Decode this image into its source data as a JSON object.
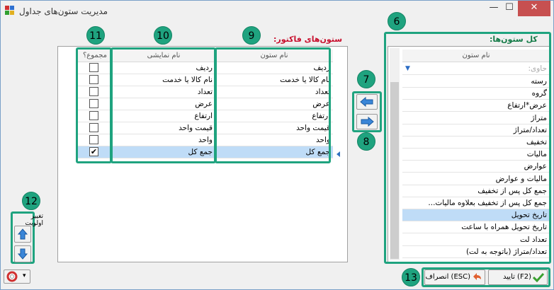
{
  "window": {
    "title": "مدیریت ستون‌های جداول"
  },
  "title_buttons": {
    "minimize": "—",
    "maximize": "☐",
    "close": "✕"
  },
  "left_grid": {
    "label": "ستون‌های فاکتور:",
    "headers": {
      "column_name": "نام ستون",
      "display_name": "نام نمایشی",
      "sum": "مجموع؟"
    },
    "rows": [
      {
        "column_name": "ردیف",
        "display_name": "ردیف",
        "sum": false
      },
      {
        "column_name": "نام کالا یا خدمت",
        "display_name": "نام کالا یا خدمت",
        "sum": false
      },
      {
        "column_name": "تعداد",
        "display_name": "تعداد",
        "sum": false
      },
      {
        "column_name": "عرض",
        "display_name": "عرض",
        "sum": false
      },
      {
        "column_name": "ارتفاع",
        "display_name": "ارتفاع",
        "sum": false
      },
      {
        "column_name": "قیمت واحد",
        "display_name": "قیمت واحد",
        "sum": false
      },
      {
        "column_name": "واحد",
        "display_name": "واحد",
        "sum": false
      },
      {
        "column_name": "جمع کل",
        "display_name": "جمع کل",
        "sum": true
      }
    ],
    "selected_index": 7
  },
  "right_grid": {
    "label": "کل ستون‌ها:",
    "header": "نام ستون",
    "filter_placeholder": "حاوی:",
    "rows": [
      "رسته",
      "گروه",
      "عرض*ارتفاع",
      "متراژ",
      "تعداد/متراژ",
      "تخفیف",
      "مالیات",
      "عوارض",
      "مالیات و عوارض",
      "جمع کل پس از تخفیف",
      "جمع کل پس از تخفیف بعلاوه مالیات...",
      "تاریخ تحویل",
      "تاریخ تحویل همراه با ساعت",
      "تعداد لت",
      "تعداد/متراژ (باتوجه به لت)"
    ],
    "selected_index": 11
  },
  "priority": {
    "label": "تغییر اولویت"
  },
  "footer": {
    "confirm": "(F2) تایید",
    "cancel": "(ESC) انصراف"
  },
  "badges": {
    "b6": "6",
    "b7": "7",
    "b8": "8",
    "b9": "9",
    "b10": "10",
    "b11": "11",
    "b12": "12",
    "b13": "13"
  },
  "colors": {
    "highlight": "#1fa37f",
    "selected_row": "#bfdcf7",
    "label_red": "#c8102e",
    "label_green": "#127a46"
  }
}
